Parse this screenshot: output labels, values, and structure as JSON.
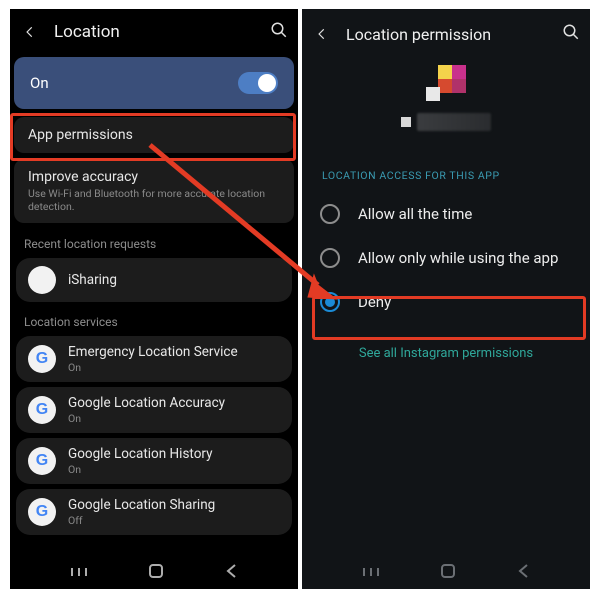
{
  "left": {
    "title": "Location",
    "toggle_label": "On",
    "app_permissions_label": "App permissions",
    "improve": {
      "title": "Improve accuracy",
      "desc": "Use Wi-Fi and Bluetooth for more accurate location detection."
    },
    "recent_header": "Recent location requests",
    "recent": [
      {
        "name": "iSharing"
      }
    ],
    "services_header": "Location services",
    "services": [
      {
        "name": "Emergency Location Service",
        "state": "On"
      },
      {
        "name": "Google Location Accuracy",
        "state": "On"
      },
      {
        "name": "Google Location History",
        "state": "On"
      },
      {
        "name": "Google Location Sharing",
        "state": "Off"
      }
    ]
  },
  "right": {
    "title": "Location permission",
    "caption": "LOCATION ACCESS FOR THIS APP",
    "options": [
      {
        "label": "Allow all the time",
        "selected": false
      },
      {
        "label": "Allow only while using the app",
        "selected": false
      },
      {
        "label": "Deny",
        "selected": true
      }
    ],
    "see_all": "See all Instagram permissions"
  },
  "annotation": {
    "highlight_left": "app-permissions",
    "highlight_right": "deny-option",
    "arrow": true
  }
}
